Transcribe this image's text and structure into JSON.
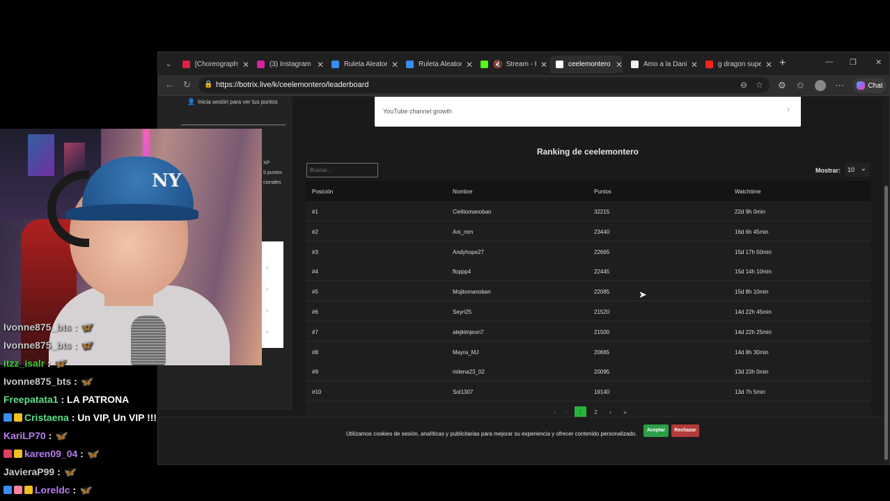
{
  "browser": {
    "tabs": [
      {
        "label": "[Choreography",
        "color": "#e02040",
        "active": false
      },
      {
        "label": "(3) Instagram -",
        "color": "#d6249f",
        "active": false
      },
      {
        "label": "Ruleta Aleatoria",
        "color": "#3a8ef0",
        "active": false
      },
      {
        "label": "Ruleta Aleatoria",
        "color": "#3a8ef0",
        "active": false
      },
      {
        "label": "Stream - K",
        "color": "#53fc18",
        "active": false,
        "muted": true
      },
      {
        "label": "ceelemontero",
        "color": "#ffffff",
        "active": true
      },
      {
        "label": "Amo a la Danie",
        "color": "#eeeeee",
        "active": false
      },
      {
        "label": "g dragon super",
        "color": "#ff2020",
        "active": false
      }
    ],
    "url": "https://botrix.live/k/ceelemontero/leaderboard",
    "chat_label": "Chat"
  },
  "sidebar": {
    "login_hint": "Inicia sesión para ver tus puntos",
    "partial_texts": [
      "XP",
      "5 puntos",
      "cionales"
    ]
  },
  "main": {
    "yt_card": "YouTube channel growth",
    "ranking_title": "Ranking de ceelemontero",
    "search_placeholder": "Buscar...",
    "show_label": "Mostrar:",
    "show_value": "10",
    "columns": [
      "Posición",
      "Nombre",
      "Puntos",
      "Watchtime"
    ],
    "rows": [
      [
        "#1",
        "Cielitomanoban",
        "32215",
        "22d 9h 0min"
      ],
      [
        "#2",
        "Ani_mm",
        "23440",
        "16d 6h 45min"
      ],
      [
        "#3",
        "Andyhope27",
        "22665",
        "15d 17h 50min"
      ],
      [
        "#4",
        "floppp4",
        "22445",
        "15d 14h 10min"
      ],
      [
        "#5",
        "Mojitomanoban",
        "22085",
        "15d 8h 10min"
      ],
      [
        "#6",
        "Seyri25",
        "21520",
        "14d 22h 45min"
      ],
      [
        "#7",
        "alejkimjeon7",
        "21500",
        "14d 22h 25min"
      ],
      [
        "#8",
        "Mayra_MJ",
        "20665",
        "14d 8h 30min"
      ],
      [
        "#9",
        "milena23_02",
        "20095",
        "13d 23h 0min"
      ],
      [
        "#10",
        "Sol1307",
        "19140",
        "13d 7h 5min"
      ]
    ],
    "pager": {
      "first": "«",
      "prev": "‹",
      "pages": [
        "1",
        "2"
      ],
      "current": "1",
      "next": "›",
      "last": "»"
    }
  },
  "cookie": {
    "text": "Utilizamos cookies de sesión, analíticas y publicitarias para mejorar su experiencia y ofrecer contenido personalizado.",
    "accept": "Aceptar",
    "reject": "Rechazar"
  },
  "chat": [
    {
      "user": "Ivonne875_bts",
      "color": "#c8c8c8",
      "text": " : ",
      "emote": "🦋"
    },
    {
      "user": "Ivonne875_bts",
      "color": "#c8c8c8",
      "text": " : ",
      "emote": "🦋"
    },
    {
      "user": "itzz_isalr",
      "color": "#3ecf3e",
      "text": " : ",
      "emote": "🦋"
    },
    {
      "user": "Ivonne875_bts",
      "color": "#c8c8c8",
      "text": " : ",
      "emote": "🦋"
    },
    {
      "user": "Freepatata1",
      "color": "#5fe08a",
      "text": " : LA PATRONA",
      "emote": ""
    },
    {
      "user": "Cristaena",
      "color": "#5fe08a",
      "text": " : Un VIP, Un VIP !!!",
      "emote": "",
      "badges": [
        "#3a8ef0",
        "#f0c020"
      ]
    },
    {
      "user": "KariLP70",
      "color": "#b77cf0",
      "text": " : ",
      "emote": "🦋"
    },
    {
      "user": "karen09_04",
      "color": "#b77cf0",
      "text": " : ",
      "emote": "🦋",
      "badges": [
        "#e04060",
        "#f0c020"
      ]
    },
    {
      "user": "JavieraP99",
      "color": "#c8c8c8",
      "text": " : ",
      "emote": "🦋"
    },
    {
      "user": "Loreldc",
      "color": "#b77cf0",
      "text": " : ",
      "emote": "🦋",
      "badges": [
        "#3a8ef0",
        "#ff80a0",
        "#f0c020"
      ]
    }
  ]
}
